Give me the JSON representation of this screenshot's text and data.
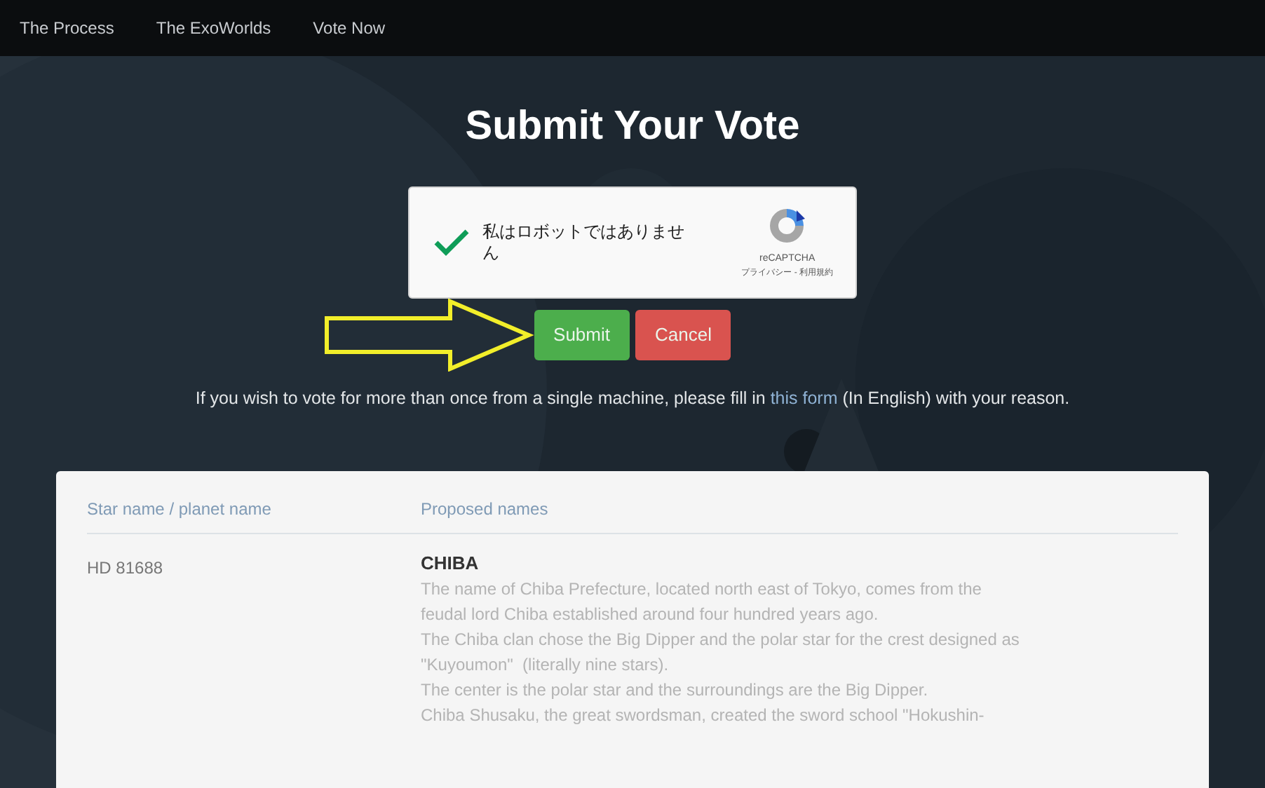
{
  "nav": {
    "items": [
      {
        "label": "The Process"
      },
      {
        "label": "The ExoWorlds"
      },
      {
        "label": "Vote Now"
      }
    ]
  },
  "title": "Submit Your Vote",
  "captcha": {
    "checked": true,
    "label": "私はロボットではありません",
    "brand": "reCAPTCHA",
    "terms": "プライバシー - 利用規約"
  },
  "buttons": [
    {
      "label": "Submit",
      "kind": "primary"
    },
    {
      "label": "Cancel",
      "kind": "danger"
    }
  ],
  "note": {
    "before": "If you wish to vote for more than once from a single machine, please fill in",
    "link": "this form",
    "after": "(In English) with your reason."
  },
  "table": {
    "columns": [
      "Star name / planet name",
      "Proposed names"
    ],
    "rows": [
      {
        "star": "HD 81688",
        "name": "CHIBA",
        "description": [
          "The name of Chiba Prefecture, located north east of Tokyo, comes from the",
          "feudal lord Chiba established around four hundred years ago.",
          "The Chiba clan chose the Big Dipper and the polar star for the crest designed as",
          "\"Kuyoumon\"  (literally nine stars).",
          "The center is the polar star and the surroundings are the Big Dipper.",
          "Chiba Shusaku, the great swordsman, created the sword school \"Hokushin-"
        ]
      }
    ]
  }
}
